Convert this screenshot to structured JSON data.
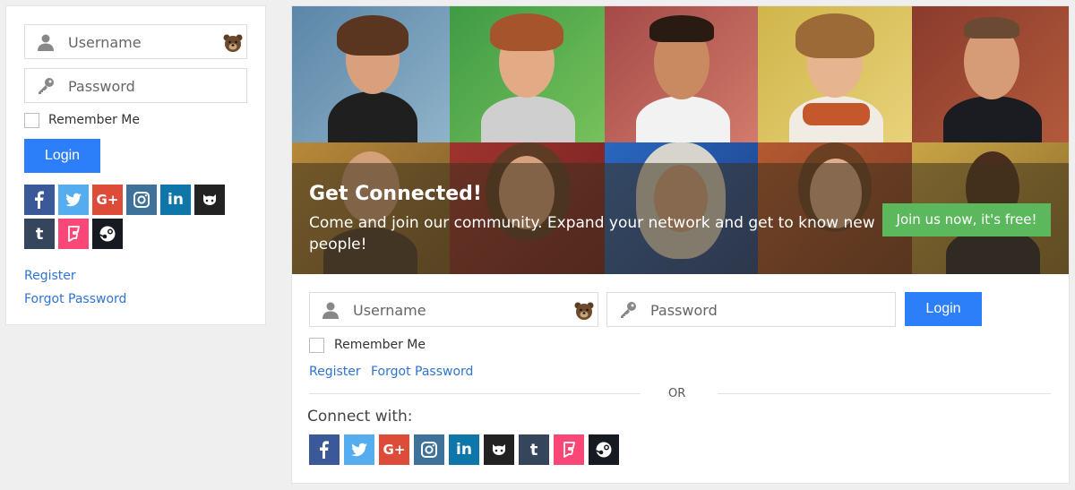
{
  "left": {
    "username_placeholder": "Username",
    "password_placeholder": "Password",
    "remember_label": "Remember Me",
    "login_label": "Login",
    "register_label": "Register",
    "forgot_label": "Forgot Password",
    "social": [
      "facebook",
      "twitter",
      "google-plus",
      "instagram",
      "linkedin",
      "github",
      "tumblr",
      "foursquare",
      "steam"
    ]
  },
  "right": {
    "hero_title": "Get Connected!",
    "hero_subtitle": "Come and join our community. Expand your network and get to know new people!",
    "cta_label": "Join us now, it's free!",
    "username_placeholder": "Username",
    "password_placeholder": "Password",
    "login_label": "Login",
    "remember_label": "Remember Me",
    "register_label": "Register",
    "forgot_label": "Forgot Password",
    "or_label": "OR",
    "connect_label": "Connect with:",
    "social": [
      "facebook",
      "twitter",
      "google-plus",
      "instagram",
      "linkedin",
      "github",
      "tumblr",
      "foursquare",
      "steam"
    ]
  },
  "colors": {
    "facebook": "#3b5998",
    "twitter": "#55acee",
    "google-plus": "#dd4b39",
    "instagram": "#3f729b",
    "linkedin": "#0e76a8",
    "github": "#222222",
    "tumblr": "#35465c",
    "foursquare": "#f94877",
    "steam": "#171a21",
    "accent": "#2d7ff9",
    "cta": "#5cb85c"
  }
}
